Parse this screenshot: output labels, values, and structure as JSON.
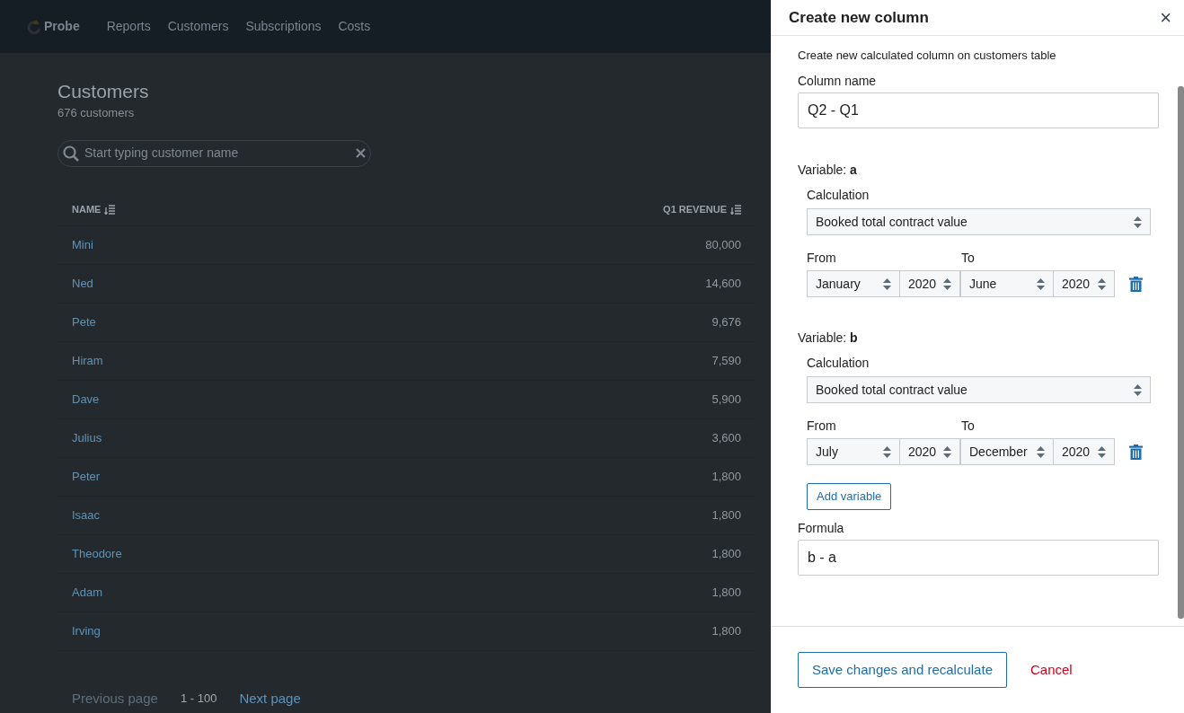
{
  "nav": {
    "brand": "Probe",
    "items": [
      "Reports",
      "Customers",
      "Subscriptions",
      "Costs"
    ]
  },
  "page": {
    "title": "Customers",
    "subtitle": "676 customers",
    "search": {
      "placeholder": "Start typing customer name"
    }
  },
  "table": {
    "columns": [
      "NAME",
      "Q1 REVENUE"
    ],
    "rows": [
      [
        "Mini",
        "80,000"
      ],
      [
        "Ned",
        "14,600"
      ],
      [
        "Pete",
        "9,676"
      ],
      [
        "Hiram",
        "7,590"
      ],
      [
        "Dave",
        "5,900"
      ],
      [
        "Julius",
        "3,600"
      ],
      [
        "Peter",
        "1,800"
      ],
      [
        "Isaac",
        "1,800"
      ],
      [
        "Theodore",
        "1,800"
      ],
      [
        "Adam",
        "1,800"
      ],
      [
        "Irving",
        "1,800"
      ]
    ]
  },
  "pagination": {
    "previous": {
      "label": "Previous page",
      "disabled": true
    },
    "range": "1 - 100",
    "next": {
      "label": "Next page",
      "disabled": false
    }
  },
  "panel": {
    "title": "Create new column",
    "close": "×",
    "description": "Create new calculated column on customers table",
    "column_name_label": "Column name",
    "column_name": "Q2 - Q1",
    "variables": [
      {
        "label": "Variable:",
        "name": "a",
        "calculation_label": "Calculation",
        "calculation": "Booked total contract value",
        "from_label": "From",
        "from_month": "January",
        "from_year": "2020",
        "to_label": "To",
        "to_month": "June",
        "to_year": "2020"
      },
      {
        "label": "Variable:",
        "name": "b",
        "calculation_label": "Calculation",
        "calculation": "Booked total contract value",
        "from_label": "From",
        "from_month": "July",
        "from_year": "2020",
        "to_label": "To",
        "to_month": "December",
        "to_year": "2020"
      }
    ],
    "add_variable": "Add variable",
    "formula_label": "Formula",
    "formula": "b - a",
    "save": "Save changes and recalculate",
    "cancel": "Cancel"
  }
}
